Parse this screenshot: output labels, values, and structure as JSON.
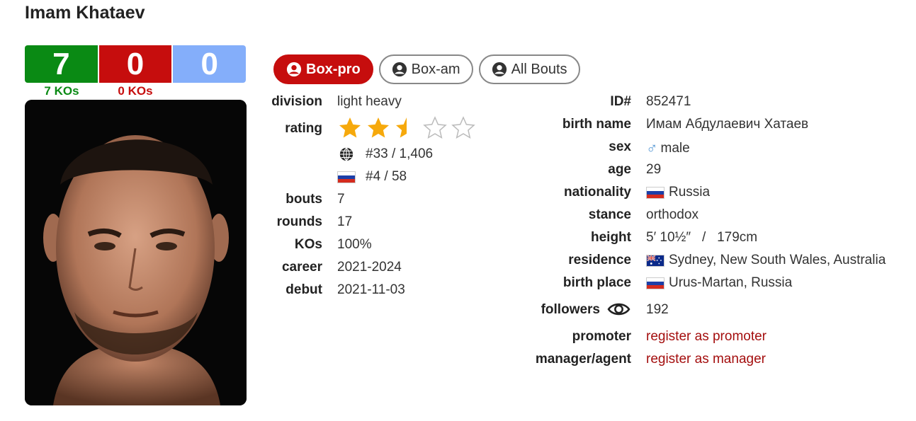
{
  "boxer": {
    "name": "Imam Khataev"
  },
  "record": {
    "wins": "7",
    "losses": "0",
    "draws": "0",
    "win_kos": "7 KOs",
    "loss_kos": "0 KOs"
  },
  "colors": {
    "win": "#0a8a14",
    "loss": "#c60d0d",
    "draw": "#84aefa",
    "link": "#a40e0e"
  },
  "tabs": [
    {
      "label": "Box-pro",
      "icon": "user-circle-icon",
      "active": true
    },
    {
      "label": "Box-am",
      "icon": "user-circle-icon",
      "active": false
    },
    {
      "label": "All Bouts",
      "icon": "user-circle-icon",
      "active": false
    }
  ],
  "left_info": {
    "division_label": "division",
    "division": "light heavy",
    "rating_label": "rating",
    "rating_stars": 2.5,
    "rating_max": 5,
    "world_rank": "#33 / 1,406",
    "country_rank": "#4 / 58",
    "bouts_label": "bouts",
    "bouts": "7",
    "rounds_label": "rounds",
    "rounds": "17",
    "kos_label": "KOs",
    "kos": "100%",
    "career_label": "career",
    "career": "2021-2024",
    "debut_label": "debut",
    "debut": "2021-11-03"
  },
  "right_info": {
    "id_label": "ID#",
    "id": "852471",
    "birth_name_label": "birth name",
    "birth_name": "Имам Абдулаевич Хатаев",
    "sex_label": "sex",
    "sex": "male",
    "age_label": "age",
    "age": "29",
    "nationality_label": "nationality",
    "nationality": "Russia",
    "stance_label": "stance",
    "stance": "orthodox",
    "height_label": "height",
    "height": "5′ 10½″   /   179cm",
    "residence_label": "residence",
    "residence": "Sydney, New South Wales, Australia",
    "birth_place_label": "birth place",
    "birth_place": "Urus-Martan, Russia",
    "followers_label": "followers",
    "followers": "192",
    "promoter_label": "promoter",
    "promoter": "register as promoter",
    "manager_label": "manager/agent",
    "manager": "register as manager"
  }
}
